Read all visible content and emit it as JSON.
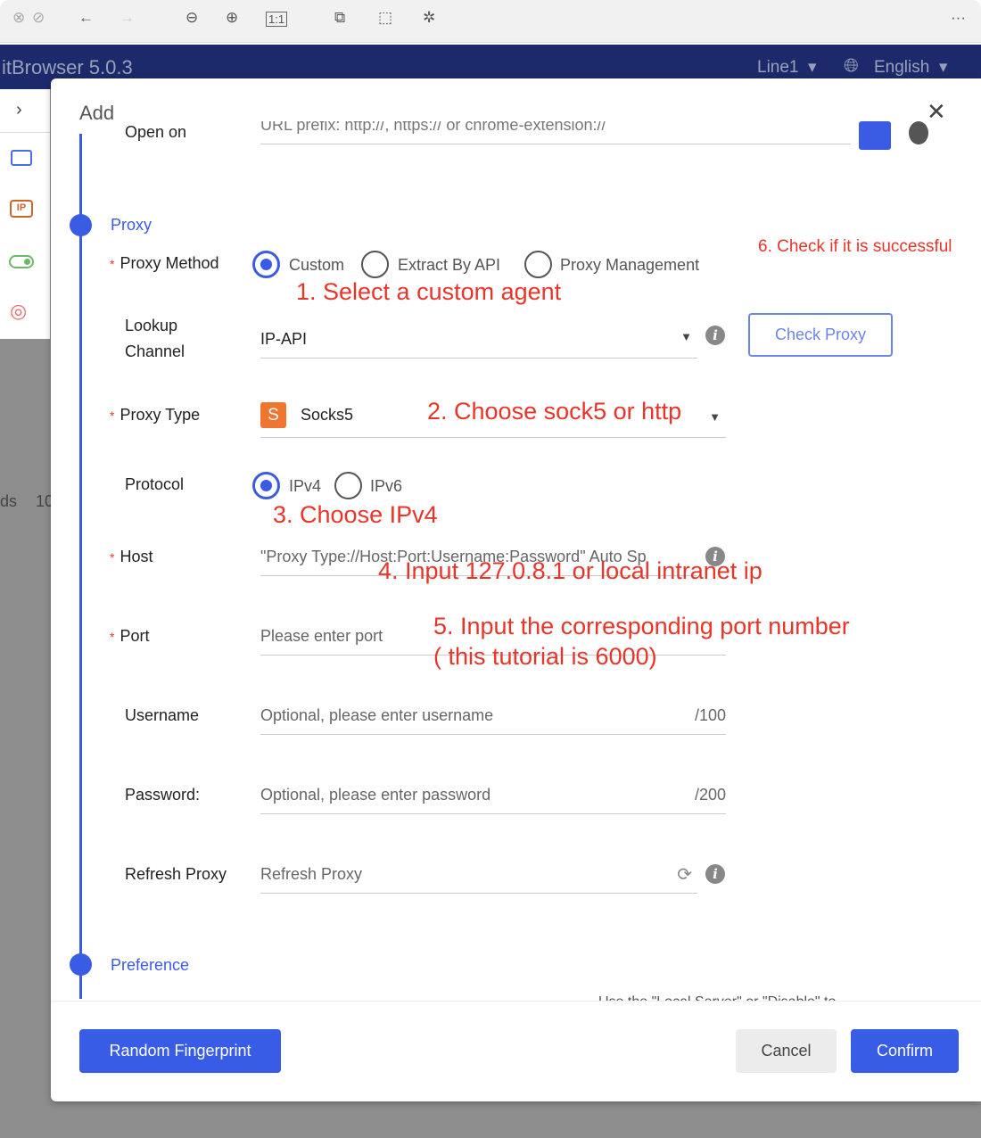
{
  "toolbar": {
    "more": "···"
  },
  "header": {
    "title": "itBrowser 5.0.3",
    "line": "Line1",
    "language": "English"
  },
  "background": {
    "partial_text_1": "ds",
    "partial_text_2": "10"
  },
  "modal": {
    "title": "Add",
    "open_on_label": "Open on",
    "open_on_placeholder": "URL prefix: http://, https:// or chrome-extension://",
    "section_proxy": "Proxy",
    "section_preference": "Preference",
    "preference_hint": "Use the \"Local Server\" or \"Disable\" to",
    "proxy_method": {
      "label": "Proxy Method",
      "options": [
        "Custom",
        "Extract By API",
        "Proxy Management"
      ],
      "selected": "Custom"
    },
    "lookup_channel": {
      "label_1": "Lookup",
      "label_2": "Channel",
      "value": "IP-API"
    },
    "check_proxy": "Check Proxy",
    "proxy_type": {
      "label": "Proxy Type",
      "value": "Socks5",
      "icon_letter": "S"
    },
    "protocol": {
      "label": "Protocol",
      "options": [
        "IPv4",
        "IPv6"
      ],
      "selected": "IPv4"
    },
    "host": {
      "label": "Host",
      "placeholder": "\"Proxy Type://Host:Port:Username:Password\" Auto Sp"
    },
    "port": {
      "label": "Port",
      "placeholder": "Please enter port"
    },
    "username": {
      "label": "Username",
      "placeholder": "Optional, please enter username",
      "limit": "/100"
    },
    "password": {
      "label": "Password:",
      "placeholder": "Optional, please enter password",
      "limit": "/200"
    },
    "refresh_proxy": {
      "label": "Refresh Proxy",
      "placeholder": "Refresh Proxy"
    },
    "buttons": {
      "random": "Random Fingerprint",
      "cancel": "Cancel",
      "confirm": "Confirm"
    }
  },
  "annotations": {
    "a1": "1. Select a custom agent",
    "a2": "2. Choose sock5 or http",
    "a3": "3. Choose IPv4",
    "a4": "4. Input 127.0.8.1 or local intranet ip",
    "a5_1": "5. Input the corresponding port number",
    "a5_2": "( this tutorial is 6000)",
    "a6": "6. Check if it is successful"
  },
  "colors": {
    "accent": "#3a5ce5",
    "annotation": "#e8352a",
    "header": "#1c2a6b"
  }
}
